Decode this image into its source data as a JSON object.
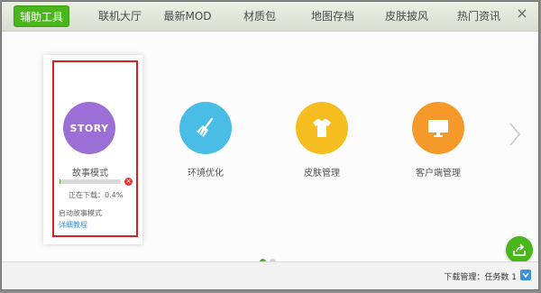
{
  "nav": {
    "tabs": [
      {
        "label": "辅助工具",
        "active": true
      },
      {
        "label": "联机大厅"
      },
      {
        "label": "最新MOD"
      },
      {
        "label": "材质包"
      },
      {
        "label": "地图存档"
      },
      {
        "label": "皮肤披风"
      },
      {
        "label": "热门资讯"
      }
    ],
    "close_glyph": "×"
  },
  "features": [
    {
      "label": "故事模式",
      "icon_text": "STORY",
      "icon": "story-icon",
      "color": "#9b6fd6"
    },
    {
      "label": "环境优化",
      "icon": "broom-icon",
      "color": "#49bde6"
    },
    {
      "label": "皮肤管理",
      "icon": "tshirt-icon",
      "color": "#f5bd1f"
    },
    {
      "label": "客户端管理",
      "icon": "monitor-icon",
      "color": "#f59a2a"
    }
  ],
  "download": {
    "status_text": "正在下载：0.4%",
    "progress_percent": 0.4,
    "cancel_glyph": "×",
    "launch_text": "启动故事模式",
    "tutorial_link": "详细教程"
  },
  "pager": {
    "pages": 2,
    "current": 1
  },
  "status": {
    "text": "下载管理：任务数 1"
  },
  "colors": {
    "accent": "#4bb51c",
    "highlight": "#d42121"
  }
}
